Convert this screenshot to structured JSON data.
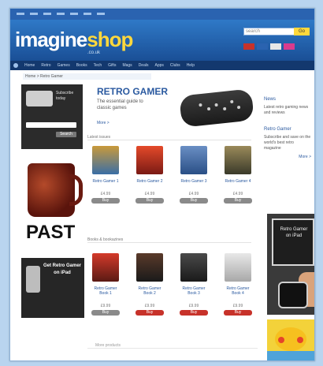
{
  "header": {
    "logo_part1": "imagine",
    "logo_part2": "shop",
    "logo_suffix": ".co.uk",
    "search_placeholder": "search",
    "search_button": "Go"
  },
  "nav": {
    "items": [
      "Home",
      "Retro",
      "Games",
      "Books",
      "Tech",
      "Gifts",
      "Mags",
      "Deals",
      "Apps",
      "Clubs",
      "Help"
    ]
  },
  "breadcrumb": "Home > Retro Gamer",
  "feature": {
    "title": "RETRO GAMER",
    "description": "The essential guide to classic games",
    "link": "More >"
  },
  "promo_box": {
    "text": "Subscribe today",
    "button": "Search"
  },
  "past_text": "PAST",
  "ipad_promo": {
    "text": "Get Retro Gamer on iPad"
  },
  "sections": {
    "top": "Latest issues",
    "bottom": "Books & bookazines",
    "footer": "More products"
  },
  "products_row1": [
    {
      "name": "Retro Gamer 1",
      "price": "£4.99",
      "buy": "Buy"
    },
    {
      "name": "Retro Gamer 2",
      "price": "£4.99",
      "buy": "Buy"
    },
    {
      "name": "Retro Gamer 3",
      "price": "£4.99",
      "buy": "Buy"
    },
    {
      "name": "Retro Gamer 4",
      "price": "£4.99",
      "buy": "Buy"
    }
  ],
  "products_row2": [
    {
      "name": "Retro Gamer Book 1",
      "price": "£9.99",
      "buy": "Buy"
    },
    {
      "name": "Retro Gamer Book 2",
      "price": "£9.99",
      "buy": "Buy"
    },
    {
      "name": "Retro Gamer Book 3",
      "price": "£9.99",
      "buy": "Buy"
    },
    {
      "name": "Retro Gamer Book 4",
      "price": "£9.99",
      "buy": "Buy"
    }
  ],
  "right_col": {
    "head1": "News",
    "text1": "Latest retro gaming news and reviews",
    "head2": "Retro Gamer",
    "text2": "Subscribe and save on the world's best retro magazine",
    "link": "More >"
  },
  "tablet_ad": {
    "text": "Retro Gamer on iPad"
  },
  "colors": {
    "brand_blue": "#2a63b0",
    "accent_yellow": "#ffd83c",
    "buy_gray": "#8a8a8a",
    "buy_red": "#c7322a"
  }
}
